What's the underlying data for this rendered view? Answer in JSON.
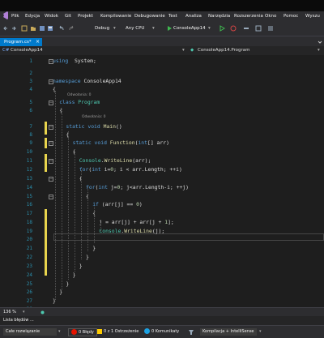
{
  "menu": [
    "Plik",
    "Edycja",
    "Widok",
    "Git",
    "Projekt",
    "Kompilowanie",
    "Debugowanie",
    "Test",
    "Analiza",
    "Narzędzia",
    "Rozszerzenia",
    "Okno",
    "Pomoc",
    "Wyszu"
  ],
  "toolbar": {
    "config": "Debug",
    "platform": "Any CPU",
    "run_label": "ConsoleApp14"
  },
  "tab": {
    "label": "Program.cs*",
    "close": "×"
  },
  "nav": {
    "left": "ConsoleApp14",
    "right": "ConsoleApp14.Program"
  },
  "code_lens": {
    "class_refs": "Odwołania: 0",
    "main_refs": "Odwołania: 0"
  },
  "code": [
    {
      "n": "1",
      "t": [
        [
          "kw",
          "using"
        ],
        [
          "",
          "  System;"
        ]
      ]
    },
    {
      "n": "2",
      "t": []
    },
    {
      "n": "3",
      "t": [
        [
          "kw",
          "namespace"
        ],
        [
          "",
          " ConsoleApp14"
        ]
      ]
    },
    {
      "n": "4",
      "t": [
        [
          "",
          "{"
        ]
      ]
    },
    {
      "n": "5",
      "t": [
        [
          "kw",
          "class"
        ],
        [
          "",
          " "
        ],
        [
          "ty",
          "Program"
        ]
      ]
    },
    {
      "n": "6",
      "t": [
        [
          "",
          "{"
        ]
      ]
    },
    {
      "n": "7",
      "t": [
        [
          "kw",
          "static"
        ],
        [
          "",
          " "
        ],
        [
          "kw",
          "void"
        ],
        [
          "",
          " "
        ],
        [
          "mt",
          "Main"
        ],
        [
          "",
          "()"
        ]
      ]
    },
    {
      "n": "8",
      "t": [
        [
          "",
          "{"
        ]
      ]
    },
    {
      "n": "9",
      "t": [
        [
          "kw",
          "static"
        ],
        [
          "",
          " "
        ],
        [
          "kw",
          "void"
        ],
        [
          "",
          " "
        ],
        [
          "mt",
          "Function"
        ],
        [
          "",
          "("
        ],
        [
          "kw",
          "int"
        ],
        [
          "",
          "[] arr)"
        ]
      ]
    },
    {
      "n": "10",
      "t": [
        [
          "",
          "{"
        ]
      ]
    },
    {
      "n": "11",
      "t": [
        [
          "ty",
          "Console"
        ],
        [
          "",
          "."
        ],
        [
          "mt",
          "WriteLine"
        ],
        [
          "",
          "(arr);"
        ]
      ]
    },
    {
      "n": "12",
      "t": [
        [
          "kw",
          "for"
        ],
        [
          "",
          "("
        ],
        [
          "kw",
          "int"
        ],
        [
          "",
          " i="
        ],
        [
          "nm",
          "0"
        ],
        [
          "",
          "; i < arr.Length; ++i)"
        ]
      ]
    },
    {
      "n": "13",
      "t": [
        [
          "",
          "{"
        ]
      ]
    },
    {
      "n": "14",
      "t": [
        [
          "kw",
          "for"
        ],
        [
          "",
          "("
        ],
        [
          "kw",
          "int"
        ],
        [
          "",
          " j="
        ],
        [
          "nm",
          "0"
        ],
        [
          "",
          "; j<arr.Length-i; ++j)"
        ]
      ]
    },
    {
      "n": "15",
      "t": [
        [
          "",
          "{"
        ]
      ]
    },
    {
      "n": "16",
      "t": [
        [
          "kw",
          "if"
        ],
        [
          "",
          " (arr[j] == "
        ],
        [
          "nm",
          "0"
        ],
        [
          "",
          ")"
        ]
      ]
    },
    {
      "n": "17",
      "t": [
        [
          "",
          "{"
        ]
      ]
    },
    {
      "n": "18",
      "t": [
        [
          "",
          "j = arr[j] + arr[j + "
        ],
        [
          "nm",
          "1"
        ],
        [
          "",
          "];"
        ]
      ]
    },
    {
      "n": "19",
      "t": [
        [
          "ty",
          "Console"
        ],
        [
          "",
          "."
        ],
        [
          "mt",
          "WriteLine"
        ],
        [
          "",
          "(j);"
        ]
      ]
    },
    {
      "n": "20",
      "t": []
    },
    {
      "n": "21",
      "t": [
        [
          "",
          "}"
        ]
      ]
    },
    {
      "n": "22",
      "t": [
        [
          "",
          "}"
        ]
      ]
    },
    {
      "n": "23",
      "t": [
        [
          "",
          "}"
        ]
      ]
    },
    {
      "n": "24",
      "t": [
        [
          "",
          "}"
        ]
      ]
    },
    {
      "n": "25",
      "t": [
        [
          "",
          "}"
        ]
      ]
    },
    {
      "n": "26",
      "t": [
        [
          "",
          "}"
        ]
      ]
    },
    {
      "n": "27",
      "t": [
        [
          "",
          "}"
        ]
      ]
    },
    {
      "n": "28",
      "t": []
    }
  ],
  "zoom": "136 %",
  "lista": "Lista błędów ...",
  "status": {
    "scope": "Całe rozwiązanie",
    "errors": "0 Błędy",
    "warnings": "0 z 1 Ostrzeżenie",
    "messages": "0 Komunikaty",
    "build": "Kompilacja + IntelliSense"
  },
  "colors": {
    "accent": "#007acc",
    "keyword": "#569cd6",
    "type": "#4ec9b0",
    "method": "#dcdcaa",
    "change_marker": "#e8d44d"
  }
}
